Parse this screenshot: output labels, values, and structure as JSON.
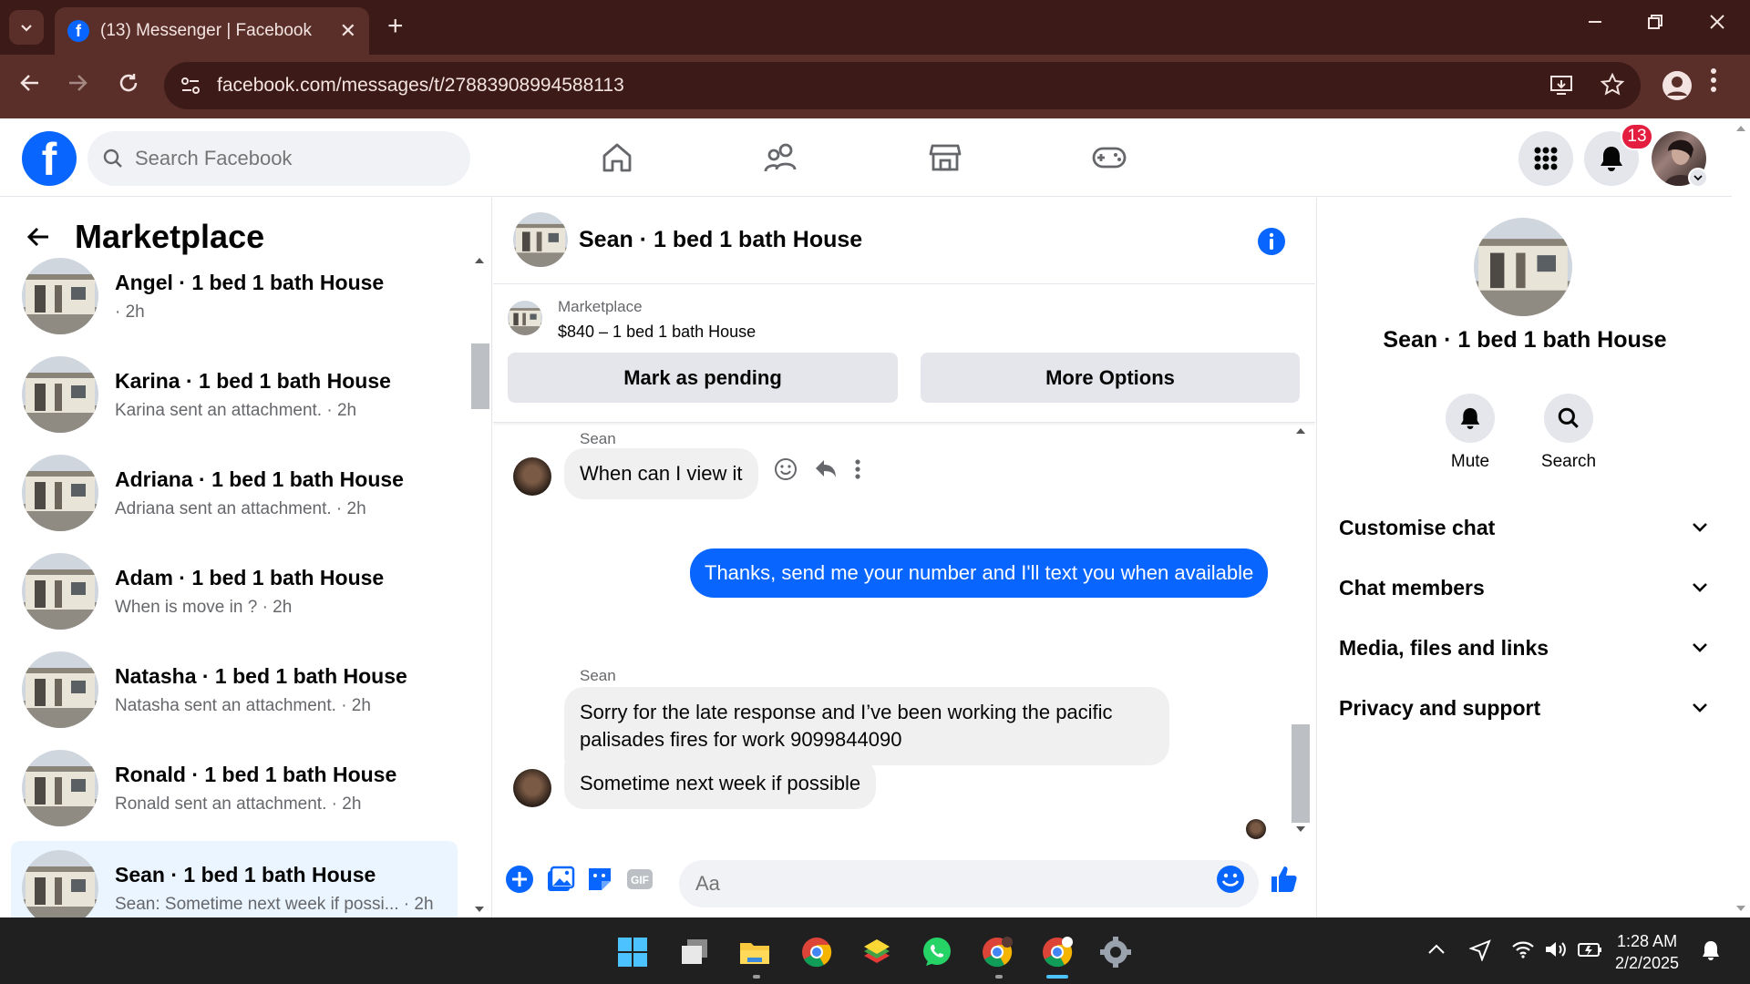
{
  "browser": {
    "tab_title": "(13) Messenger | Facebook",
    "url": "facebook.com/messages/t/27883908994588113",
    "tab_close": "✕",
    "new_tab": "+"
  },
  "fb": {
    "search_placeholder": "Search Facebook",
    "notification_count": "13"
  },
  "left": {
    "title": "Marketplace",
    "conversations": [
      {
        "name": "Angel · 1 bed 1 bath House",
        "sub": "· 2h"
      },
      {
        "name": "Karina · 1 bed 1 bath House",
        "sub": "Karina sent an attachment. · 2h"
      },
      {
        "name": "Adriana · 1 bed 1 bath House",
        "sub": "Adriana sent an attachment. · 2h"
      },
      {
        "name": "Adam · 1 bed 1 bath House",
        "sub": "When is move in ? · 2h"
      },
      {
        "name": "Natasha · 1 bed 1 bath House",
        "sub": "Natasha sent an attachment. · 2h"
      },
      {
        "name": "Ronald · 1 bed 1 bath House",
        "sub": "Ronald sent an attachment. · 2h"
      },
      {
        "name": "Sean · 1 bed 1 bath House",
        "sub": "Sean: Sometime next week if possi... · 2h"
      }
    ]
  },
  "chat": {
    "title": "Sean · 1 bed 1 bath House",
    "listing_source": "Marketplace",
    "listing_title": "$840 – 1 bed 1 bath House",
    "mark_pending": "Mark as pending",
    "more_options": "More Options",
    "messages": [
      {
        "sender": "Sean",
        "text": "When can I view it"
      },
      {
        "text": "Thanks, send me your number and I'll text you when available"
      },
      {
        "sender": "Sean",
        "text": "Sorry for the late response and I’ve been working the pacific palisades fires for work 9099844090"
      },
      {
        "text": "Sometime next week if possible"
      }
    ],
    "input_placeholder": "Aa"
  },
  "right": {
    "title": "Sean · 1 bed 1 bath House",
    "mute": "Mute",
    "search": "Search",
    "sections": [
      "Customise chat",
      "Chat members",
      "Media, files and links",
      "Privacy and support"
    ]
  },
  "taskbar": {
    "time": "1:28 AM",
    "date": "2/2/2025"
  },
  "colors": {
    "fb_blue": "#0866ff",
    "chrome_dark": "#3c1a17",
    "chrome_mid": "#5a2f2a",
    "badge_red": "#e41e3f"
  }
}
